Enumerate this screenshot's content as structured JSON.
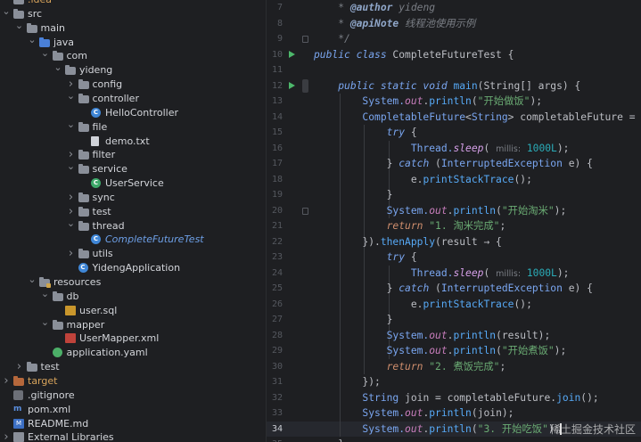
{
  "tree": {
    "rows": [
      {
        "depth": 0,
        "chevron": "",
        "icon": "folder",
        "label": ".idea",
        "cls": "c-orange"
      },
      {
        "depth": 0,
        "chevron": "v",
        "icon": "folder",
        "label": "src",
        "cls": ""
      },
      {
        "depth": 1,
        "chevron": "v",
        "icon": "folder",
        "label": "main",
        "cls": ""
      },
      {
        "depth": 2,
        "chevron": "v",
        "icon": "folder-blue",
        "label": "java",
        "cls": ""
      },
      {
        "depth": 3,
        "chevron": "v",
        "icon": "folder",
        "label": "com",
        "cls": ""
      },
      {
        "depth": 4,
        "chevron": "v",
        "icon": "folder",
        "label": "yideng",
        "cls": ""
      },
      {
        "depth": 5,
        "chevron": ">",
        "icon": "folder",
        "label": "config",
        "cls": ""
      },
      {
        "depth": 5,
        "chevron": "v",
        "icon": "folder",
        "label": "controller",
        "cls": ""
      },
      {
        "depth": 6,
        "chevron": "",
        "icon": "class",
        "label": "HelloController",
        "cls": ""
      },
      {
        "depth": 5,
        "chevron": "v",
        "icon": "folder",
        "label": "file",
        "cls": ""
      },
      {
        "depth": 6,
        "chevron": "",
        "icon": "file",
        "label": "demo.txt",
        "cls": ""
      },
      {
        "depth": 5,
        "chevron": ">",
        "icon": "folder",
        "label": "filter",
        "cls": ""
      },
      {
        "depth": 5,
        "chevron": "v",
        "icon": "folder",
        "label": "service",
        "cls": ""
      },
      {
        "depth": 6,
        "chevron": "",
        "icon": "class-green",
        "label": "UserService",
        "cls": ""
      },
      {
        "depth": 5,
        "chevron": ">",
        "icon": "folder",
        "label": "sync",
        "cls": ""
      },
      {
        "depth": 5,
        "chevron": ">",
        "icon": "folder",
        "label": "test",
        "cls": ""
      },
      {
        "depth": 5,
        "chevron": "v",
        "icon": "folder",
        "label": "thread",
        "cls": ""
      },
      {
        "depth": 6,
        "chevron": "",
        "icon": "class",
        "label": "CompleteFutureTest",
        "cls": "c-italic"
      },
      {
        "depth": 5,
        "chevron": ">",
        "icon": "folder",
        "label": "utils",
        "cls": ""
      },
      {
        "depth": 5,
        "chevron": "",
        "icon": "class",
        "label": "YidengApplication",
        "cls": ""
      },
      {
        "depth": 2,
        "chevron": "v",
        "icon": "folder-res",
        "label": "resources",
        "cls": ""
      },
      {
        "depth": 3,
        "chevron": "v",
        "icon": "folder",
        "label": "db",
        "cls": ""
      },
      {
        "depth": 4,
        "chevron": "",
        "icon": "sql",
        "label": "user.sql",
        "cls": ""
      },
      {
        "depth": 3,
        "chevron": "v",
        "icon": "folder",
        "label": "mapper",
        "cls": ""
      },
      {
        "depth": 4,
        "chevron": "",
        "icon": "xml",
        "label": "UserMapper.xml",
        "cls": ""
      },
      {
        "depth": 3,
        "chevron": "",
        "icon": "yaml",
        "label": "application.yaml",
        "cls": ""
      },
      {
        "depth": 1,
        "chevron": ">",
        "icon": "folder",
        "label": "test",
        "cls": ""
      },
      {
        "depth": 0,
        "chevron": ">",
        "icon": "folder-orange",
        "label": "target",
        "cls": "c-orange"
      },
      {
        "depth": 0,
        "chevron": "",
        "icon": "git",
        "label": ".gitignore",
        "cls": ""
      },
      {
        "depth": 0,
        "chevron": "",
        "icon": "pom",
        "label": "pom.xml",
        "cls": ""
      },
      {
        "depth": 0,
        "chevron": "",
        "icon": "md",
        "label": "README.md",
        "cls": ""
      },
      {
        "depth": 0,
        "chevron": ">",
        "icon": "lib",
        "label": "External Libraries",
        "cls": ""
      }
    ]
  },
  "editor": {
    "current_line": 34,
    "run_lines": [
      10,
      12
    ],
    "lines": [
      {
        "n": 7,
        "indent": 4,
        "segs": [
          [
            "cmt",
            "* "
          ],
          [
            "tag",
            "@author"
          ],
          [
            "cmt",
            " yideng"
          ]
        ]
      },
      {
        "n": 8,
        "indent": 4,
        "segs": [
          [
            "cmt",
            "* "
          ],
          [
            "tag",
            "@apiNote"
          ],
          [
            "cmt",
            " 线程池使用示例"
          ]
        ]
      },
      {
        "n": 9,
        "indent": 4,
        "segs": [
          [
            "cmt",
            "*/"
          ]
        ]
      },
      {
        "n": 10,
        "indent": 0,
        "segs": [
          [
            "kwb",
            "public class "
          ],
          [
            "",
            "CompleteFutureTest {"
          ]
        ]
      },
      {
        "n": 11,
        "indent": 0,
        "segs": []
      },
      {
        "n": 12,
        "indent": 4,
        "segs": [
          [
            "kwb",
            "public static void "
          ],
          [
            "fnc",
            "main"
          ],
          [
            "",
            "(String[] args) {"
          ]
        ]
      },
      {
        "n": 13,
        "indent": 8,
        "segs": [
          [
            "typ",
            "System."
          ],
          [
            "fld",
            "out"
          ],
          [
            "",
            "."
          ],
          [
            "mth",
            "println"
          ],
          [
            "",
            "("
          ],
          [
            "str",
            "\"开始做饭\""
          ],
          [
            "",
            ");"
          ]
        ]
      },
      {
        "n": 14,
        "indent": 8,
        "segs": [
          [
            "typ",
            "CompletableFuture"
          ],
          [
            "",
            "<"
          ],
          [
            "typ",
            "String"
          ],
          [
            "",
            "> completableFuture = "
          ]
        ]
      },
      {
        "n": 15,
        "indent": 12,
        "segs": [
          [
            "kwb",
            "try"
          ],
          [
            "",
            " {"
          ]
        ]
      },
      {
        "n": 16,
        "indent": 16,
        "segs": [
          [
            "typ",
            "Thread."
          ],
          [
            "sta",
            "sleep"
          ],
          [
            "",
            "( "
          ],
          [
            "hint",
            "millis:"
          ],
          [
            "",
            " "
          ],
          [
            "num",
            "1000L"
          ],
          [
            "",
            ");"
          ]
        ]
      },
      {
        "n": 17,
        "indent": 12,
        "segs": [
          [
            "",
            "} "
          ],
          [
            "kwb",
            "catch"
          ],
          [
            "",
            " ("
          ],
          [
            "typ",
            "InterruptedException"
          ],
          [
            "",
            " e) {"
          ]
        ]
      },
      {
        "n": 18,
        "indent": 16,
        "segs": [
          [
            "",
            "e."
          ],
          [
            "mth",
            "printStackTrace"
          ],
          [
            "",
            "();"
          ]
        ]
      },
      {
        "n": 19,
        "indent": 12,
        "segs": [
          [
            "",
            "}"
          ]
        ]
      },
      {
        "n": 20,
        "indent": 12,
        "segs": [
          [
            "typ",
            "System."
          ],
          [
            "fld",
            "out"
          ],
          [
            "",
            "."
          ],
          [
            "mth",
            "println"
          ],
          [
            "",
            "("
          ],
          [
            "str",
            "\"开始淘米\""
          ],
          [
            "",
            ");"
          ]
        ]
      },
      {
        "n": 21,
        "indent": 12,
        "segs": [
          [
            "kwi",
            "return "
          ],
          [
            "str",
            "\"1. 淘米完成\""
          ],
          [
            "",
            ";"
          ]
        ]
      },
      {
        "n": 22,
        "indent": 8,
        "segs": [
          [
            "",
            "})."
          ],
          [
            "mth",
            "thenApply"
          ],
          [
            "",
            "(result → {"
          ]
        ]
      },
      {
        "n": 23,
        "indent": 12,
        "segs": [
          [
            "kwb",
            "try"
          ],
          [
            "",
            " {"
          ]
        ]
      },
      {
        "n": 24,
        "indent": 16,
        "segs": [
          [
            "typ",
            "Thread."
          ],
          [
            "sta",
            "sleep"
          ],
          [
            "",
            "( "
          ],
          [
            "hint",
            "millis:"
          ],
          [
            "",
            " "
          ],
          [
            "num",
            "1000L"
          ],
          [
            "",
            ");"
          ]
        ]
      },
      {
        "n": 25,
        "indent": 12,
        "segs": [
          [
            "",
            "} "
          ],
          [
            "kwb",
            "catch"
          ],
          [
            "",
            " ("
          ],
          [
            "typ",
            "InterruptedException"
          ],
          [
            "",
            " e) {"
          ]
        ]
      },
      {
        "n": 26,
        "indent": 16,
        "segs": [
          [
            "",
            "e."
          ],
          [
            "mth",
            "printStackTrace"
          ],
          [
            "",
            "();"
          ]
        ]
      },
      {
        "n": 27,
        "indent": 12,
        "segs": [
          [
            "",
            "}"
          ]
        ]
      },
      {
        "n": 28,
        "indent": 12,
        "segs": [
          [
            "typ",
            "System."
          ],
          [
            "fld",
            "out"
          ],
          [
            "",
            "."
          ],
          [
            "mth",
            "println"
          ],
          [
            "",
            "(result);"
          ]
        ]
      },
      {
        "n": 29,
        "indent": 12,
        "segs": [
          [
            "typ",
            "System."
          ],
          [
            "fld",
            "out"
          ],
          [
            "",
            "."
          ],
          [
            "mth",
            "println"
          ],
          [
            "",
            "("
          ],
          [
            "str",
            "\"开始煮饭\""
          ],
          [
            "",
            ");"
          ]
        ]
      },
      {
        "n": 30,
        "indent": 12,
        "segs": [
          [
            "kwi",
            "return "
          ],
          [
            "str",
            "\"2. 煮饭完成\""
          ],
          [
            "",
            ";"
          ]
        ]
      },
      {
        "n": 31,
        "indent": 8,
        "segs": [
          [
            "",
            "});"
          ]
        ]
      },
      {
        "n": 32,
        "indent": 8,
        "segs": [
          [
            "typ",
            "String"
          ],
          [
            "",
            " join = completableFuture."
          ],
          [
            "mth",
            "join"
          ],
          [
            "",
            "();"
          ]
        ]
      },
      {
        "n": 33,
        "indent": 8,
        "segs": [
          [
            "typ",
            "System."
          ],
          [
            "fld",
            "out"
          ],
          [
            "",
            "."
          ],
          [
            "mth",
            "println"
          ],
          [
            "",
            "(join);"
          ]
        ]
      },
      {
        "n": 34,
        "indent": 8,
        "segs": [
          [
            "typ",
            "System."
          ],
          [
            "fld",
            "out"
          ],
          [
            "",
            "."
          ],
          [
            "mth",
            "println"
          ],
          [
            "",
            "("
          ],
          [
            "str",
            "\"3. 开始吃饭\""
          ],
          [
            "",
            ");"
          ],
          [
            "caret",
            ""
          ]
        ]
      },
      {
        "n": 35,
        "indent": 4,
        "segs": [
          [
            "",
            "}"
          ]
        ]
      }
    ]
  },
  "watermark": "稀土掘金技术社区"
}
